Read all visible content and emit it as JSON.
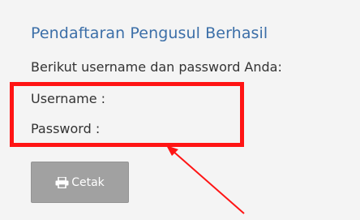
{
  "confirmation": {
    "title": "Pendaftaran Pengusul Berhasil",
    "intro": "Berikut username dan password Anda:",
    "username_label": "Username :",
    "password_label": "Password :"
  },
  "actions": {
    "print_label": "Cetak",
    "print_icon": "printer-icon"
  },
  "colors": {
    "title": "#3c6fa8",
    "text": "#333333",
    "highlight": "#ff1414",
    "button": "#a1a1a1",
    "background": "#f4f4f4"
  }
}
